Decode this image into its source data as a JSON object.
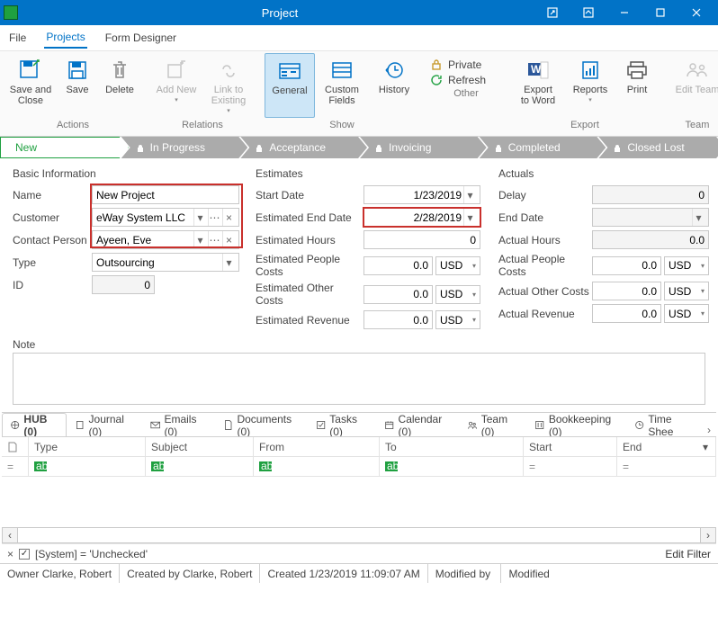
{
  "title": "Project",
  "menu": {
    "file": "File",
    "projects": "Projects",
    "formdesigner": "Form Designer"
  },
  "ribbon": {
    "actions": "Actions",
    "relations": "Relations",
    "show": "Show",
    "other": "Other",
    "export": "Export",
    "team": "Team",
    "saveandclose": "Save and\nClose",
    "save": "Save",
    "delete": "Delete",
    "addnew": "Add New",
    "linktoexisting": "Link to\nExisting",
    "general": "General",
    "customfields": "Custom\nFields",
    "history": "History",
    "private": "Private",
    "refresh": "Refresh",
    "exportword": "Export\nto Word",
    "reports": "Reports",
    "print": "Print",
    "editteam": "Edit Team"
  },
  "stages": [
    "New",
    "In Progress",
    "Acceptance",
    "Invoicing",
    "Completed",
    "Closed Lost"
  ],
  "section": {
    "basic": "Basic Information",
    "estimates": "Estimates",
    "actuals": "Actuals"
  },
  "labels": {
    "name": "Name",
    "customer": "Customer",
    "contact": "Contact Person",
    "type": "Type",
    "id": "ID",
    "startdate": "Start Date",
    "estend": "Estimated End Date",
    "esthours": "Estimated Hours",
    "estpeople": "Estimated People Costs",
    "estother": "Estimated Other Costs",
    "estrev": "Estimated Revenue",
    "delay": "Delay",
    "enddate": "End Date",
    "acthours": "Actual Hours",
    "actpeople": "Actual People Costs",
    "actother": "Actual Other Costs",
    "actrev": "Actual Revenue",
    "note": "Note"
  },
  "values": {
    "name": "New Project",
    "customer": "eWay System LLC",
    "contact": "Ayeen, Eve",
    "type": "Outsourcing",
    "id": "0",
    "startdate": "1/23/2019",
    "estend": "2/28/2019",
    "esthours": "0",
    "estpeople": "0.0",
    "estother": "0.0",
    "estrev": "0.0",
    "delay": "0",
    "enddate": "",
    "acthours": "0.0",
    "actpeople": "0.0",
    "actother": "0.0",
    "actrev": "0.0",
    "cur": "USD"
  },
  "tabs": {
    "hub": "HUB (0)",
    "journal": "Journal (0)",
    "emails": "Emails (0)",
    "documents": "Documents (0)",
    "tasks": "Tasks (0)",
    "calendar": "Calendar (0)",
    "team": "Team (0)",
    "book": "Bookkeeping (0)",
    "timesheet": "Time Shee"
  },
  "grid": {
    "new": "",
    "type": "Type",
    "subject": "Subject",
    "from": "From",
    "to": "To",
    "start": "Start",
    "end": "End",
    "filtericon": "▫",
    "eq": "=",
    "abc": "▫"
  },
  "filterExpr": "[System] = 'Unchecked'",
  "editFilter": "Edit Filter",
  "status": {
    "owner_lbl": "Owner",
    "owner": "Clarke, Robert",
    "createdby_lbl": "Created by",
    "createdby": "Clarke, Robert",
    "created_lbl": "Created",
    "created": "1/23/2019 11:09:07 AM",
    "modby_lbl": "Modified by",
    "modby": "",
    "mod_lbl": "Modified",
    "mod": ""
  }
}
